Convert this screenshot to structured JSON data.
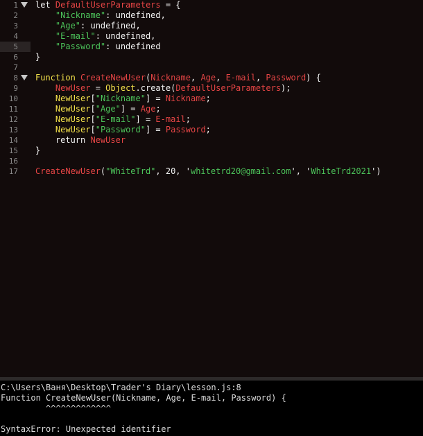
{
  "editor": {
    "active_line": 5,
    "lines": [
      {
        "num": "1",
        "fold": true,
        "segments": [
          {
            "t": "let ",
            "c": "kw"
          },
          {
            "t": "DefaultUserParameters",
            "c": "var"
          },
          {
            "t": " = {",
            "c": "kw"
          }
        ]
      },
      {
        "num": "2",
        "fold": false,
        "segments": [
          {
            "t": "    ",
            "c": "kw"
          },
          {
            "t": "\"Nickname\"",
            "c": "str"
          },
          {
            "t": ": undefined,",
            "c": "kw"
          }
        ]
      },
      {
        "num": "3",
        "fold": false,
        "segments": [
          {
            "t": "    ",
            "c": "kw"
          },
          {
            "t": "\"Age\"",
            "c": "str"
          },
          {
            "t": ": undefined,",
            "c": "kw"
          }
        ]
      },
      {
        "num": "4",
        "fold": false,
        "segments": [
          {
            "t": "    ",
            "c": "kw"
          },
          {
            "t": "\"E-mail\"",
            "c": "str"
          },
          {
            "t": ": undefined,",
            "c": "kw"
          }
        ]
      },
      {
        "num": "5",
        "fold": false,
        "segments": [
          {
            "t": "    ",
            "c": "kw"
          },
          {
            "t": "\"Password\"",
            "c": "str"
          },
          {
            "t": ": undefined",
            "c": "kw"
          }
        ]
      },
      {
        "num": "6",
        "fold": false,
        "segments": [
          {
            "t": "}",
            "c": "kw"
          }
        ]
      },
      {
        "num": "7",
        "fold": false,
        "segments": []
      },
      {
        "num": "8",
        "fold": true,
        "segments": [
          {
            "t": "Function ",
            "c": "kwy"
          },
          {
            "t": "CreateNewUser",
            "c": "fn"
          },
          {
            "t": "(",
            "c": "kw"
          },
          {
            "t": "Nickname",
            "c": "var"
          },
          {
            "t": ", ",
            "c": "kw"
          },
          {
            "t": "Age",
            "c": "var"
          },
          {
            "t": ", ",
            "c": "kw"
          },
          {
            "t": "E-mail",
            "c": "var"
          },
          {
            "t": ", ",
            "c": "kw"
          },
          {
            "t": "Password",
            "c": "var"
          },
          {
            "t": ") {",
            "c": "kw"
          }
        ]
      },
      {
        "num": "9",
        "fold": false,
        "segments": [
          {
            "t": "    ",
            "c": "kw"
          },
          {
            "t": "NewUser",
            "c": "var"
          },
          {
            "t": " = ",
            "c": "kw"
          },
          {
            "t": "Object",
            "c": "yel"
          },
          {
            "t": ".create(",
            "c": "kw"
          },
          {
            "t": "DefaultUserParameters",
            "c": "var"
          },
          {
            "t": ");",
            "c": "kw"
          }
        ]
      },
      {
        "num": "10",
        "fold": false,
        "segments": [
          {
            "t": "    ",
            "c": "kw"
          },
          {
            "t": "NewUser",
            "c": "yel"
          },
          {
            "t": "[",
            "c": "kw"
          },
          {
            "t": "\"Nickname\"",
            "c": "str"
          },
          {
            "t": "] = ",
            "c": "kw"
          },
          {
            "t": "Nickname",
            "c": "var"
          },
          {
            "t": ";",
            "c": "kw"
          }
        ]
      },
      {
        "num": "11",
        "fold": false,
        "segments": [
          {
            "t": "    ",
            "c": "kw"
          },
          {
            "t": "NewUser",
            "c": "yel"
          },
          {
            "t": "[",
            "c": "kw"
          },
          {
            "t": "\"Age\"",
            "c": "str"
          },
          {
            "t": "] = ",
            "c": "kw"
          },
          {
            "t": "Age",
            "c": "var"
          },
          {
            "t": ";",
            "c": "kw"
          }
        ]
      },
      {
        "num": "12",
        "fold": false,
        "segments": [
          {
            "t": "    ",
            "c": "kw"
          },
          {
            "t": "NewUser",
            "c": "yel"
          },
          {
            "t": "[",
            "c": "kw"
          },
          {
            "t": "\"E-mail\"",
            "c": "str"
          },
          {
            "t": "] = ",
            "c": "kw"
          },
          {
            "t": "E-mail",
            "c": "var"
          },
          {
            "t": ";",
            "c": "kw"
          }
        ]
      },
      {
        "num": "13",
        "fold": false,
        "segments": [
          {
            "t": "    ",
            "c": "kw"
          },
          {
            "t": "NewUser",
            "c": "yel"
          },
          {
            "t": "[",
            "c": "kw"
          },
          {
            "t": "\"Password\"",
            "c": "str"
          },
          {
            "t": "] = ",
            "c": "kw"
          },
          {
            "t": "Password",
            "c": "var"
          },
          {
            "t": ";",
            "c": "kw"
          }
        ]
      },
      {
        "num": "14",
        "fold": false,
        "segments": [
          {
            "t": "    return ",
            "c": "kw"
          },
          {
            "t": "NewUser",
            "c": "var"
          }
        ]
      },
      {
        "num": "15",
        "fold": false,
        "segments": [
          {
            "t": "}",
            "c": "kw"
          }
        ]
      },
      {
        "num": "16",
        "fold": false,
        "segments": []
      },
      {
        "num": "17",
        "fold": false,
        "segments": [
          {
            "t": "CreateNewUser",
            "c": "fn"
          },
          {
            "t": "(",
            "c": "kw"
          },
          {
            "t": "\"WhiteTrd\"",
            "c": "str"
          },
          {
            "t": ", 20, '",
            "c": "kw"
          },
          {
            "t": "whitetrd20@gmail.com",
            "c": "str"
          },
          {
            "t": "', '",
            "c": "kw"
          },
          {
            "t": "WhiteTrd2021",
            "c": "str"
          },
          {
            "t": "')",
            "c": "kw"
          }
        ]
      }
    ]
  },
  "console": {
    "path_line": "C:\\Users\\Ваня\\Desktop\\Trader's Diary\\lesson.js:8",
    "source_line": "Function CreateNewUser(Nickname, Age, E-mail, Password) {",
    "caret_line": "         ^^^^^^^^^^^^^",
    "blank_line": "",
    "error_line": "SyntaxError: Unexpected identifier"
  },
  "colors": {
    "background": "#120b0b",
    "string": "#4cc35a",
    "identifier": "#e54545",
    "keyword_yellow": "#f2e04a",
    "plain": "#f2f2f2",
    "console_bg": "#000000"
  }
}
